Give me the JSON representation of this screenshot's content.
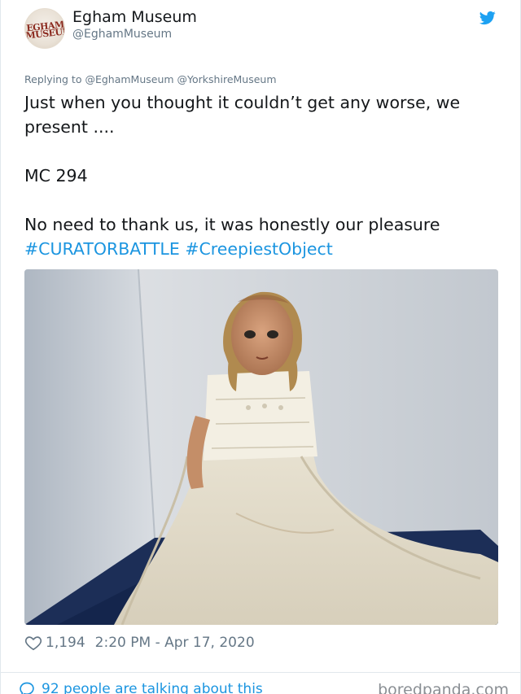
{
  "tweet": {
    "display_name": "Egham Museum",
    "handle": "@EghamMuseum",
    "avatar_text": "EGHAM MUSEUM",
    "replying_prefix": "Replying to",
    "replying_to": "@EghamMuseum @YorkshireMuseum",
    "line1": "Just when you thought it couldn’t get any worse, we",
    "line2": "present ....",
    "line3": "MC 294",
    "line4": "No need to thank us, it was honestly our pleasure",
    "hashtags": "#CURATORBATTLE #CreepiestObject",
    "likes": "1,194",
    "timestamp": "2:20 PM - Apr 17, 2020",
    "talking": "92 people are talking about this"
  },
  "watermark": "boredpanda.com",
  "icons": {
    "bird": "twitter-bird-icon",
    "heart": "heart-icon",
    "bubble": "comment-bubble-icon"
  },
  "colors": {
    "link": "#1b95e0",
    "twitter_blue": "#1da1f2",
    "muted": "#657786"
  }
}
